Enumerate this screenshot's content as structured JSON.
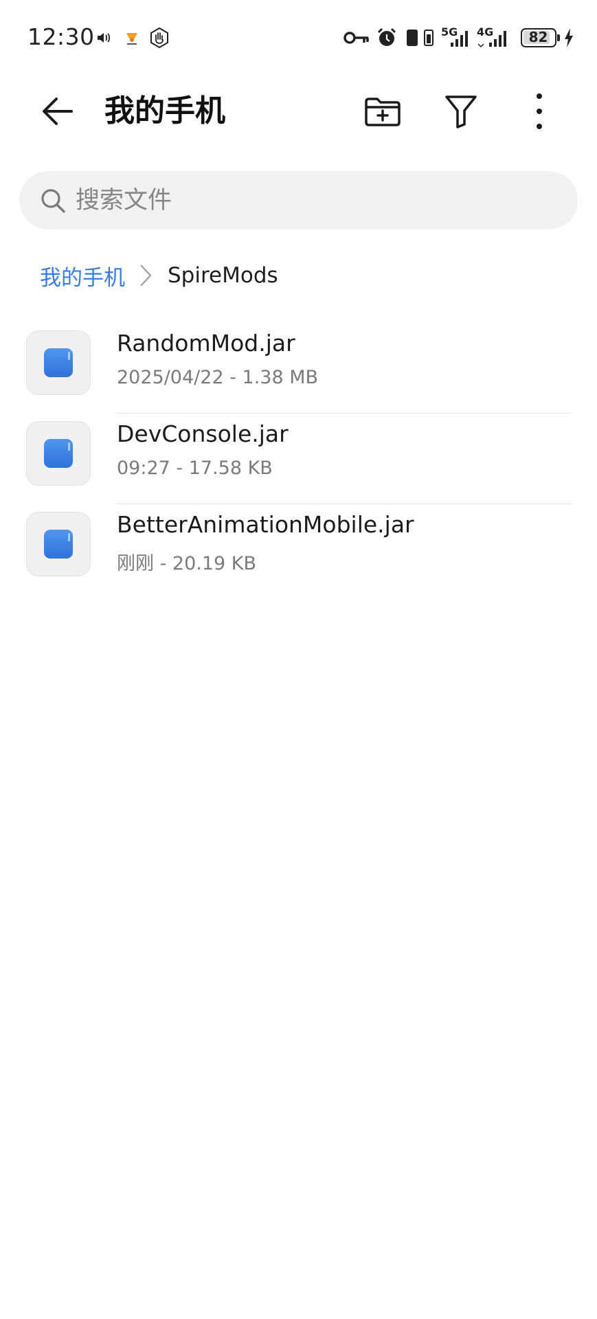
{
  "status_bar": {
    "time": "12:30",
    "signal_5g_label": "5G",
    "signal_4g_label": "4G",
    "battery_level": "82",
    "icons": [
      "volume-icon",
      "notification-icon",
      "hand-icon",
      "vpn-key-icon",
      "alarm-icon",
      "sim-icon",
      "vibrate-icon",
      "signal-5g-icon",
      "signal-4g-icon",
      "battery-icon",
      "charging-icon"
    ]
  },
  "app_bar": {
    "title": "我的手机",
    "actions": [
      "new-folder-icon",
      "filter-icon",
      "more-icon"
    ]
  },
  "search": {
    "placeholder": "搜索文件"
  },
  "breadcrumb": {
    "root": "我的手机",
    "current": "SpireMods"
  },
  "files": [
    {
      "name": "RandomMod.jar",
      "meta": "2025/04/22 - 1.38 MB"
    },
    {
      "name": "DevConsole.jar",
      "meta": "09:27 - 17.58 KB"
    },
    {
      "name": "BetterAnimationMobile.jar",
      "meta": "刚刚 - 20.19 KB"
    }
  ],
  "colors": {
    "accent": "#3a7be0",
    "jar_icon": "#3b82e6",
    "search_bg": "#f1f1f1"
  }
}
